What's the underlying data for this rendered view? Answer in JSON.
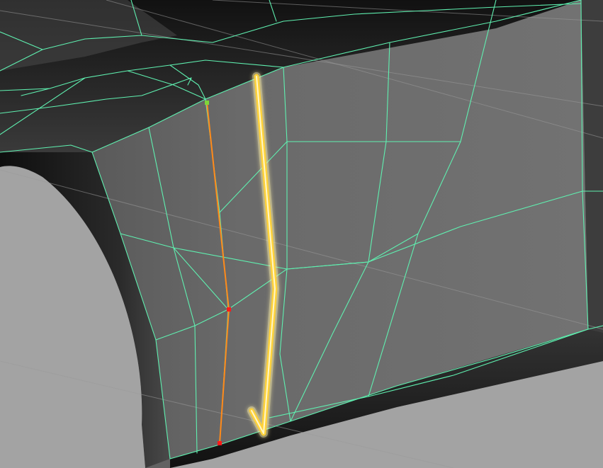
{
  "viewport": {
    "name": "3d-modeling-viewport",
    "background_color": "#6e6e6e",
    "floor_color": "#a3a3a3",
    "surface_color": "#6a6a6a",
    "shadow_color": "#1c1c1c"
  },
  "wireframe": {
    "edge_color": "#5ff0b0",
    "grid_line_color": "#9a9a9a"
  },
  "selection": {
    "edge_loop_color": "#ff8a1a",
    "start_vertex_color": "#7dd63a",
    "vertex_color": "#ff1a1a"
  },
  "annotation": {
    "arrow_color": "#ffd23a",
    "arrow_glow_color": "#fff2a8",
    "arrow_direction": "down"
  }
}
